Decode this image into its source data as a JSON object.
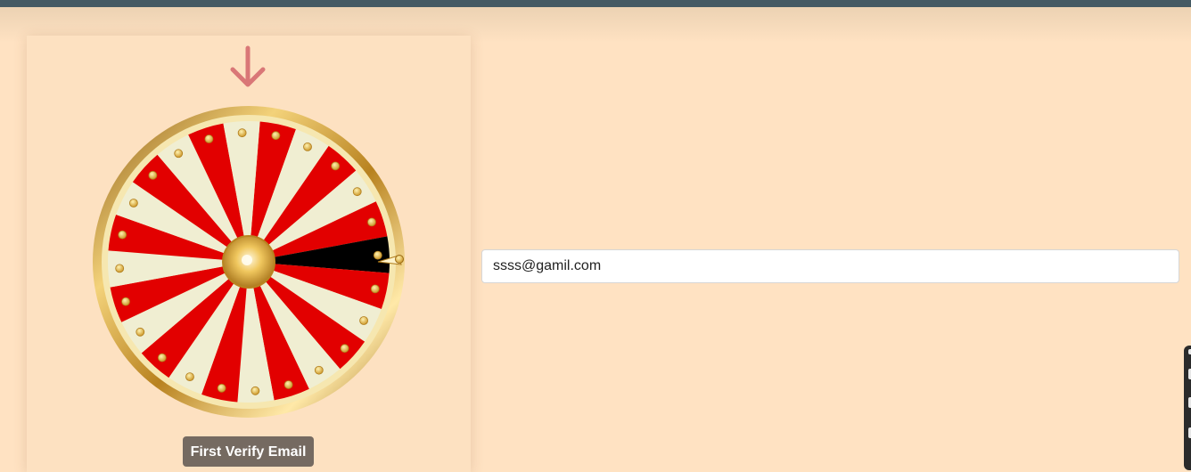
{
  "form": {
    "email_value": "ssss@gamil.com",
    "verify_button_label": "First Verify Email"
  },
  "wheel": {
    "segment_count": 24,
    "highlighted_segment_color": "#000000",
    "colors": {
      "red": "#e20000",
      "cream": "#f0eed2",
      "gold": "#d8a53a",
      "arrow": "#d97777"
    }
  },
  "icons": {
    "pointer": "arrow-down-icon",
    "wheel_needle": "needle-icon"
  }
}
